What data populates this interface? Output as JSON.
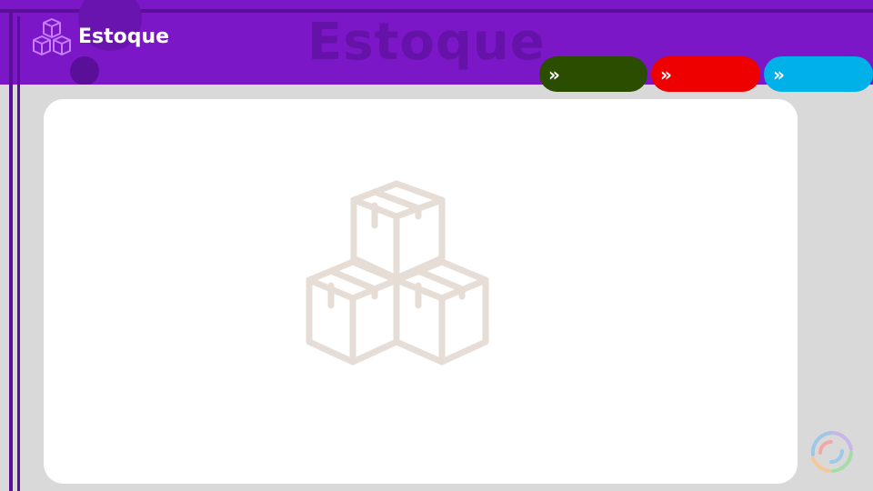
{
  "header": {
    "title": "Estoque",
    "ghost_title": "Estoque",
    "logo_icon": "boxes-icon",
    "background": "#7b17c7"
  },
  "nav_buttons": [
    {
      "icon": "double-chevron-right-icon",
      "label": "",
      "color": "#2b4d00"
    },
    {
      "icon": "double-chevron-right-icon",
      "label": "",
      "color": "#ee0000"
    },
    {
      "icon": "double-chevron-right-icon",
      "label": "",
      "color": "#00b0e8"
    }
  ],
  "main": {
    "placeholder_icon": "boxes-icon",
    "icon_color": "#e6ded6"
  },
  "loader_icon": "loading-ring-icon"
}
